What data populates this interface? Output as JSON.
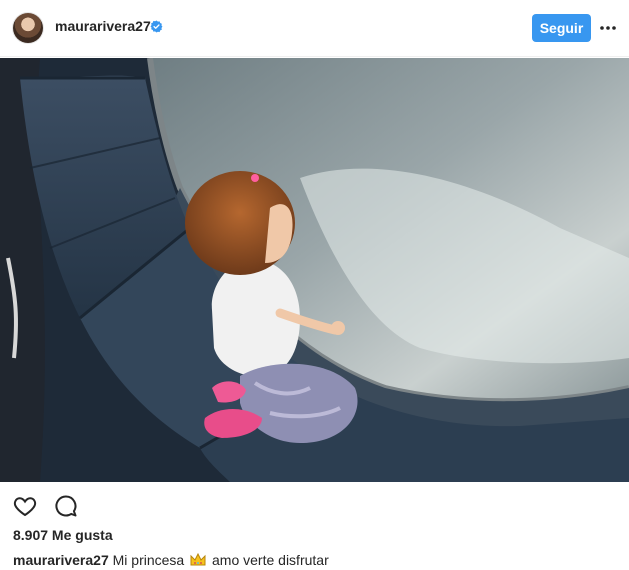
{
  "header": {
    "username": "maurarivera27",
    "verified_icon": "verified-badge-icon",
    "follow_label": "Seguir",
    "more_icon": "more-options-icon"
  },
  "post": {
    "actions": {
      "like_icon": "heart-icon",
      "comment_icon": "comment-icon"
    },
    "likes_text": "8.907 Me gusta",
    "caption": {
      "username": "maurarivera27",
      "text_before": "Mi princesa",
      "emoji_icon": "crown-emoji-icon",
      "text_after": "amo verte disfrutar"
    }
  },
  "colors": {
    "accent": "#3897f0",
    "text": "#262626"
  }
}
